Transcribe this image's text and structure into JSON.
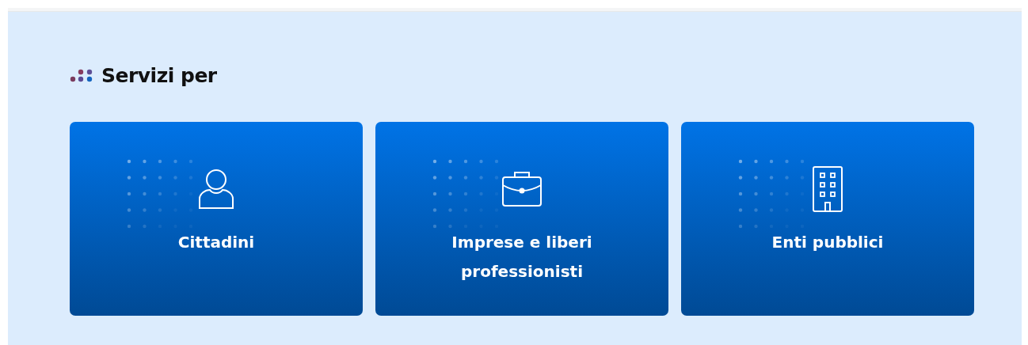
{
  "section": {
    "title": "Servizi per"
  },
  "cards": [
    {
      "kind": "person",
      "label": "Cittadini"
    },
    {
      "kind": "briefcase",
      "label": "Imprese e liberi professionisti"
    },
    {
      "kind": "building",
      "label": "Enti pubblici"
    }
  ]
}
